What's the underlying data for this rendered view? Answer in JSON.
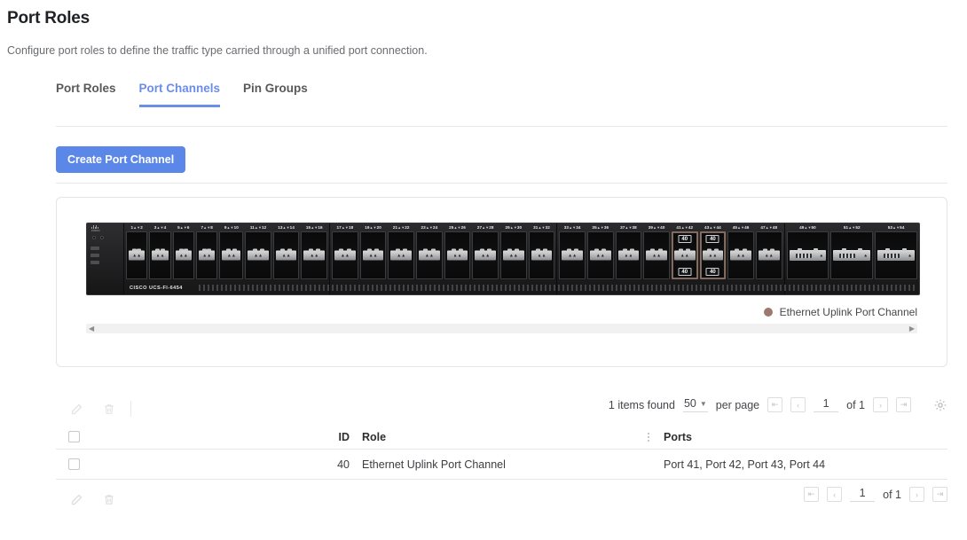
{
  "header": {
    "title": "Port Roles",
    "subtitle": "Configure port roles to define the traffic type carried through a unified port connection."
  },
  "tabs": [
    {
      "label": "Port Roles",
      "active": false
    },
    {
      "label": "Port Channels",
      "active": true
    },
    {
      "label": "Pin Groups",
      "active": false
    }
  ],
  "toolbar": {
    "create_label": "Create Port Channel"
  },
  "switch": {
    "model": "CISCO UCS-FI-6454",
    "vendor_logo": "cisco",
    "badge_label": "40",
    "selected_ports": [
      41,
      42,
      43,
      44
    ],
    "port_pairs": [
      "1▲▼2",
      "3▲▼4",
      "5▲▼6",
      "7▲▼8",
      "9▲▼10",
      "11▲▼12",
      "13▲▼14",
      "15▲▼16",
      "17▲▼18",
      "19▲▼20",
      "21▲▼22",
      "23▲▼24",
      "25▲▼26",
      "27▲▼28",
      "29▲▼30",
      "31▲▼32",
      "33▲▼34",
      "35▲▼36",
      "37▲▼38",
      "39▲▼40",
      "41▲▼42",
      "43▲▼44",
      "45▲▼46",
      "47▲▼48",
      "49▲▼50",
      "51▲▼52",
      "53▲▼54"
    ],
    "legend": {
      "label": "Ethernet Uplink Port Channel",
      "color": "#9e7870"
    },
    "scrollbar": {
      "left_arrow": "◀",
      "right_arrow": "▶"
    }
  },
  "table": {
    "items_found": "1 items found",
    "per_page_value": "50",
    "per_page_label": "per page",
    "page_current": "1",
    "page_of": "of 1",
    "columns": [
      "ID",
      "Role",
      "Ports"
    ],
    "rows": [
      {
        "id": "40",
        "role": "Ethernet Uplink Port Channel",
        "ports": "Port 41, Port 42, Port 43, Port 44"
      }
    ]
  },
  "colors": {
    "accent": "#6b8ee8",
    "primary_button": "#5b87e8",
    "legend_dot": "#9e7870",
    "text": "#2e2f31",
    "muted_text": "#6a6c70"
  }
}
